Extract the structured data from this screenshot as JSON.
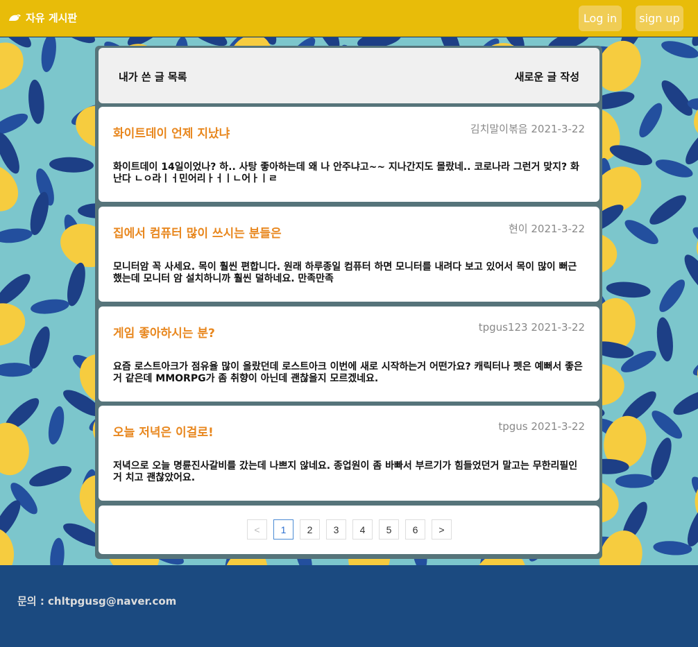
{
  "header": {
    "brand": "자유 게시판",
    "login_label": "Log in",
    "signup_label": "sign up"
  },
  "menu": {
    "my_posts": "내가 쓴 글 목록",
    "new_post": "새로운 글 작성"
  },
  "posts": [
    {
      "title": "화이트데이 언제 지났냐",
      "author": "김치말이볶음",
      "date": "2021-3-22",
      "body": "화이트데이 14일이었나? 하.. 사탕 좋아하는데 왜 나 안주냐고~~ 지나간지도 몰랐네.. 코로나라 그런거 맞지? 화난다 ㄴㅇ라ㅣㅓ민어리ㅏㅓㅣㄴ어ㅏㅣㄹ"
    },
    {
      "title": "집에서 컴퓨터 많이 쓰시는 분들은",
      "author": "현이",
      "date": "2021-3-22",
      "body": "모니터암 꼭 사세요. 목이 훨씬 편합니다. 원래 하루종일 컴퓨터 하면 모니터를 내려다 보고 있어서 목이 많이 뻐근했는데 모니터 암 설치하니까 훨씬 덜하네요. 만족만족"
    },
    {
      "title": "게임 좋아하시는 분?",
      "author": "tpgus123",
      "date": "2021-3-22",
      "body": "요즘 로스트아크가 점유율 많이 올랐던데 로스트아크 이번에 새로 시작하는거 어떤가요? 캐릭터나 펫은 예뻐서 좋은거 같은데 MMORPG가 좀 취향이 아닌데 괜찮을지 모르겠네요."
    },
    {
      "title": "오늘 저녁은 이걸로!",
      "author": "tpgus",
      "date": "2021-3-22",
      "body": "저녁으로 오늘 명륜진사갈비를 갔는데 나쁘지 않네요. 종업원이 좀 바빠서 부르기가 힘들었던거 말고는 무한리필인거 치고 괜찮았어요."
    }
  ],
  "pagination": {
    "prev": "<",
    "pages": [
      "1",
      "2",
      "3",
      "4",
      "5",
      "6"
    ],
    "current": "1",
    "next": ">"
  },
  "footer": {
    "contact": "문의 : chltpgusg@naver.com"
  },
  "colors": {
    "header_bg": "#e8bc09",
    "title_accent": "#e8871e",
    "footer_bg": "#1b4a80",
    "pattern_leaf": "#1d3f86",
    "pattern_lemon": "#f6cc3f",
    "pattern_bg": "#7cc6cc"
  }
}
